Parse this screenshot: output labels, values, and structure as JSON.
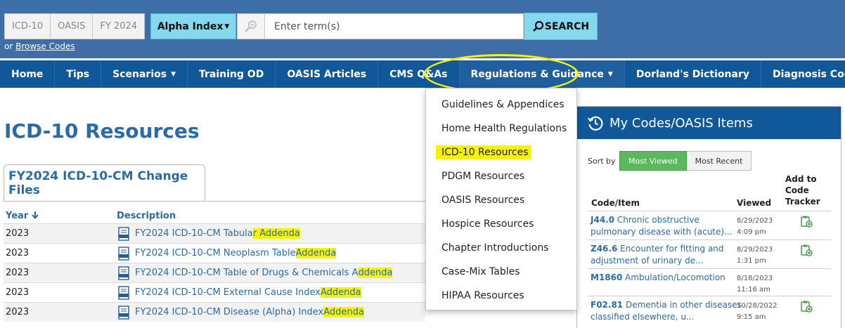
{
  "header": {
    "code_tabs": [
      "ICD-10",
      "OASIS",
      "FY 2024"
    ],
    "alpha_index_label": "Alpha Index",
    "search_placeholder": "Enter term(s)",
    "search_button_label": "SEARCH",
    "browse_prefix": "or",
    "browse_link": "Browse Codes"
  },
  "nav": {
    "items": [
      "Home",
      "Tips",
      "Scenarios",
      "Training OD",
      "OASIS Articles",
      "CMS Q&As",
      "Regulations & Guidance",
      "Dorland's Dictionary",
      "Diagnosis Coding Pro"
    ]
  },
  "dropdown": {
    "items": [
      "Guidelines & Appendices",
      "Home Health Regulations",
      "ICD-10 Resources",
      "PDGM Resources",
      "OASIS Resources",
      "Hospice Resources",
      "Chapter Introductions",
      "Case-Mix Tables",
      "HIPAA Resources"
    ]
  },
  "main": {
    "title": "ICD-10 Resources",
    "section_title": "FY2024 ICD-10-CM Change Files",
    "columns": {
      "year": "Year",
      "description": "Description"
    },
    "rows": [
      {
        "year": "2023",
        "pre": "FY2024 ICD-10-CM Tabula",
        "hl": "r Addenda"
      },
      {
        "year": "2023",
        "pre": "FY2024 ICD-10-CM Neoplasm Table ",
        "hl": "Addenda"
      },
      {
        "year": "2023",
        "pre": "FY2024 ICD-10-CM Table of Drugs & Chemicals A",
        "hl": "ddenda"
      },
      {
        "year": "2023",
        "pre": "FY2024 ICD-10-CM External Cause Index ",
        "hl": "Addenda"
      },
      {
        "year": "2023",
        "pre": "FY2024 ICD-10-CM Disease (Alpha) Index ",
        "hl": "Addenda"
      }
    ]
  },
  "side": {
    "title": "My Codes/OASIS Items",
    "sort_label": "Sort by",
    "sort_most_viewed": "Most Viewed",
    "sort_most_recent": "Most Recent",
    "col_code": "Code/Item",
    "col_viewed": "Viewed",
    "col_tracker_1": "Add to",
    "col_tracker_2": "Code",
    "col_tracker_3": "Tracker",
    "rows": [
      {
        "code": "J44.0",
        "line1": " Chronic obstructive",
        "line2": "pulmonary disease with (acute)...",
        "date": "8/29/2023",
        "time": "4:09 pm"
      },
      {
        "code": "Z46.6",
        "line1": " Encounter for fitting and",
        "line2": "adjustment of urinary de...",
        "date": "8/29/2023",
        "time": "1:31 pm"
      },
      {
        "code": "M1860",
        "line1": " Ambulation/Locomotion",
        "line2": "",
        "date": "8/18/2023",
        "time": "11:16 am"
      },
      {
        "code": "F02.81",
        "line1": " Dementia in other diseases",
        "line2": "classified elsewhere, u...",
        "date": "10/28/2022",
        "time": "9:15 am"
      }
    ]
  },
  "colors": {
    "header_bg": "#3d6ea8",
    "nav_bg": "#10589a",
    "accent_button": "#86d8ee",
    "link": "#2b6aa8",
    "highlight": "#f7f200",
    "sort_active": "#5cb85c"
  }
}
